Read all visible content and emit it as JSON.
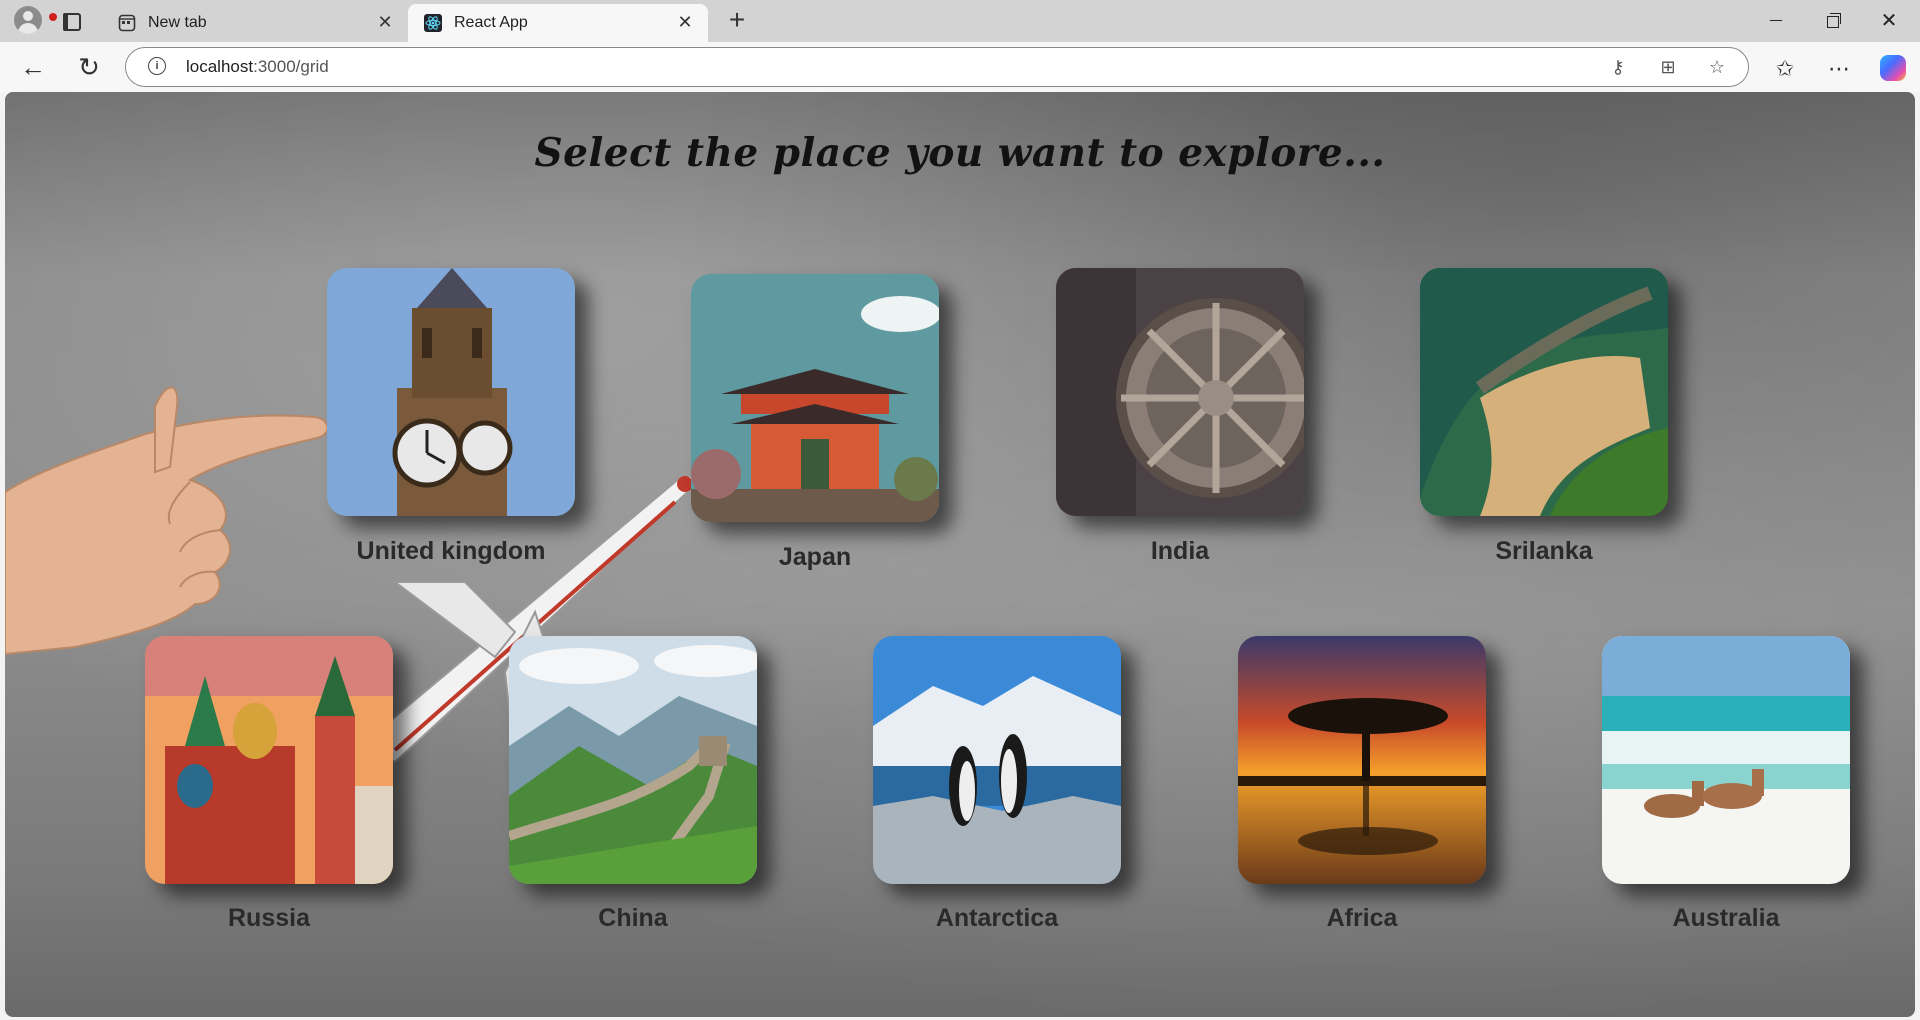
{
  "browser": {
    "tabs": [
      {
        "title": "New tab",
        "active": false
      },
      {
        "title": "React App",
        "active": true
      }
    ],
    "address": {
      "host": "localhost",
      "path": ":3000/grid"
    },
    "icons": [
      "profile-icon",
      "tab-actions-icon",
      "back-icon",
      "reload-icon",
      "info-icon",
      "key-icon",
      "apps-icon",
      "star-icon",
      "favorites-icon",
      "more-icon",
      "copilot-icon"
    ]
  },
  "page": {
    "heading": "Select the place you want to explore...",
    "places": [
      {
        "name": "United kingdom",
        "image": "big-ben"
      },
      {
        "name": "Japan",
        "image": "japanese-gate"
      },
      {
        "name": "India",
        "image": "konark-wheel"
      },
      {
        "name": "Srilanka",
        "image": "coast-aerial"
      },
      {
        "name": "Russia",
        "image": "russian-cathedral"
      },
      {
        "name": "China",
        "image": "great-wall"
      },
      {
        "name": "Antarctica",
        "image": "penguins"
      },
      {
        "name": "Africa",
        "image": "acacia-sunset"
      },
      {
        "name": "Australia",
        "image": "kangaroos-beach"
      }
    ],
    "colors": {
      "heading": "#121212",
      "label": "#2a2a2a",
      "background": "#8a8a8a"
    }
  }
}
